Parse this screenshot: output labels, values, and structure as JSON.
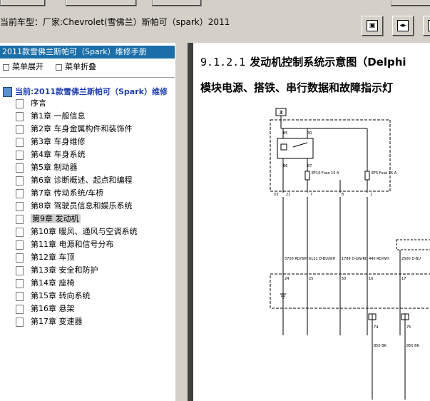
{
  "toolbar": {
    "buttons": [
      "",
      "",
      ""
    ]
  },
  "model_label": "当前车型：厂家:Chevrolet(雪佛兰）斯帕可（spark）2011",
  "nav": [
    "▣",
    "◂▸",
    "▸"
  ],
  "tree": {
    "header": "2011款雪佛兰斯帕可（Spark）维修手册",
    "expand": "菜单展开",
    "collapse": "菜单折叠",
    "root": "当前:2011款雪佛兰斯帕可（Spark）维修",
    "items": [
      "序言",
      "第1章 一般信息",
      "第2章 车身金属构件和装饰件",
      "第3章 车身维修",
      "第4章 车身系统",
      "第5章 制动器",
      "第6章 诊断概述、起点和编程",
      "第7章 传动系统/车桥",
      "第8章 驾驶员信息和娱乐系统",
      "第9章 发动机",
      "第10章 暖风、通风与空调系统",
      "第11章 电源和信号分布",
      "第12章 车顶",
      "第13章 安全和防护",
      "第14章 座椅",
      "第15章 转向系统",
      "第16章 悬架",
      "第17章 变速器"
    ],
    "selected_index": 9
  },
  "content": {
    "section_number": "9.1.2.1",
    "section_title": "发动机控制系统示意图（Delphi",
    "subtitle": "模块电源、搭铁、串行数据和故障指示灯",
    "diagram": {
      "top_box": "3",
      "relay_pins": [
        "85",
        "30",
        "86",
        "87"
      ],
      "fuses": [
        "EF10 Fuse 15 A",
        "EF5 Fuse 15 A"
      ],
      "connector": "X3",
      "connector_pins": [
        "21",
        "7",
        "8",
        "1"
      ],
      "wires": [
        "5700 RD/WH",
        "6121 D-BU/WH",
        "1789 D-GN/RD",
        "440 RD/WH",
        "2500 D-BU"
      ],
      "ecm_pins": [
        "24",
        "25",
        "50",
        "16",
        "17"
      ],
      "bottom_pins": [
        "74",
        "75"
      ],
      "bottom_wires": [
        "850 BK",
        "850 BK"
      ]
    }
  }
}
